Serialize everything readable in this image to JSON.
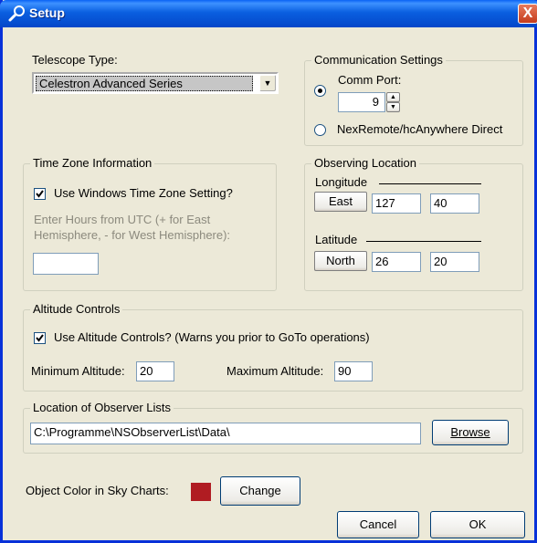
{
  "window": {
    "title": "Setup",
    "close_symbol": "X"
  },
  "telescope": {
    "label": "Telescope Type:",
    "selected": "Celestron Advanced Series",
    "dropdown_arrow": "▼"
  },
  "comm": {
    "legend": "Communication Settings",
    "port_label": "Comm Port:",
    "port_value": "9",
    "nexremote_label": "NexRemote/hcAnywhere Direct",
    "selected_option": "Comm Port"
  },
  "timezone": {
    "legend": "Time Zone Information",
    "checkbox_label": "Use Windows Time Zone Setting?",
    "checked": true,
    "hint": "Enter Hours from UTC (+ for East Hemisphere, - for West Hemisphere):",
    "hours_value": ""
  },
  "observing": {
    "legend": "Observing Location",
    "longitude_label": "Longitude",
    "longitude_dir": "East",
    "longitude_deg": "127",
    "longitude_min": "40",
    "latitude_label": "Latitude",
    "latitude_dir": "North",
    "latitude_deg": "26",
    "latitude_min": "20"
  },
  "altitude": {
    "legend": "Altitude Controls",
    "checkbox_label": "Use Altitude Controls? (Warns you prior to GoTo operations)",
    "checked": true,
    "min_label": "Minimum Altitude:",
    "min_value": "20",
    "max_label": "Maximum Altitude:",
    "max_value": "90"
  },
  "observer_lists": {
    "legend": "Location of Observer Lists",
    "path": "C:\\Programme\\NSObserverList\\Data\\",
    "browse_label": "Browse"
  },
  "object_color": {
    "label": "Object Color in Sky Charts:",
    "color": "#b01c22",
    "change_label": "Change"
  },
  "buttons": {
    "cancel": "Cancel",
    "ok": "OK"
  }
}
